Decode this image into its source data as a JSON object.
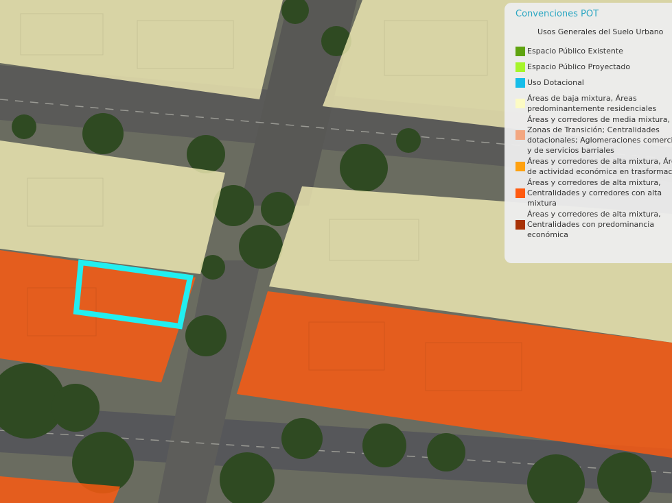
{
  "legend": {
    "title": "Convenciones POT",
    "subtitle": "Usos Generales del Suelo Urbano",
    "items": [
      {
        "label": "Espacio Público Existente",
        "color": "#5fa30f",
        "icon": "swatch"
      },
      {
        "label": "Espacio Público Proyectado",
        "color": "#a6f52a",
        "icon": "swatch"
      },
      {
        "label": "Uso Dotacional",
        "color": "#16bde9",
        "icon": "swatch"
      },
      {
        "label": "Áreas de baja mixtura, Áreas\npredominantemente residenciales",
        "color": "#fcfbc4",
        "icon": "swatch"
      },
      {
        "label": "Áreas y corredores de media mixtura,\nZonas de Transición; Centralidades\ndotacionales; Aglomeraciones comerciales\ny de servicios barriales",
        "color": "#f3a781",
        "icon": "swatch"
      },
      {
        "label": "Áreas y corredores de alta mixtura, Áreas\nde actividad económica en trasformación",
        "color": "#ffa10f",
        "icon": "swatch"
      },
      {
        "label": "Áreas y corredores de alta mixtura,\nCentralidades y corredores con alta\nmixtura",
        "color": "#ff5a10",
        "icon": "swatch"
      },
      {
        "label": "Áreas y corredores de alta mixtura,\nCentralidades con predominancia\neconómica",
        "color": "#a83206",
        "icon": "swatch"
      }
    ]
  },
  "map": {
    "zones": [
      {
        "use": "Áreas de baja mixtura, Áreas predominantemente residenciales",
        "color": "#f7f1b8"
      },
      {
        "use": "Áreas y corredores de alta mixtura, Centralidades y corredores con alta mixtura",
        "color": "#ff5a10"
      }
    ],
    "selection_color": "#22eef0"
  }
}
